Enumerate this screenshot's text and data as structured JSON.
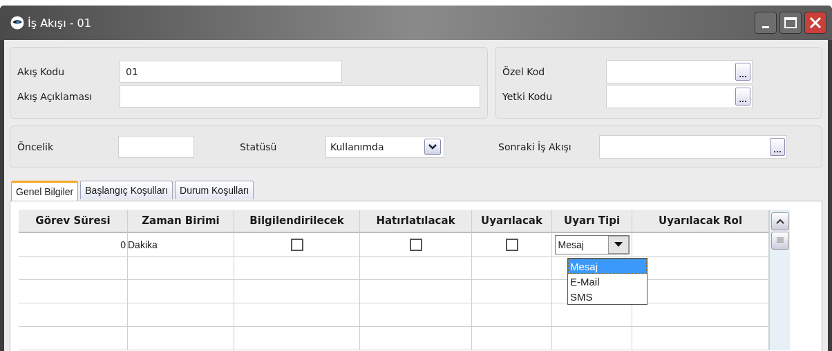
{
  "window": {
    "title": "İş Akışı - 01"
  },
  "header_left": [
    {
      "label": "Akış Kodu",
      "value": "01"
    },
    {
      "label": "Akış Açıklaması"
    }
  ],
  "header_right": [
    {
      "label": "Özel Kod",
      "button": "..."
    },
    {
      "label": "Yetki Kodu",
      "button": "..."
    }
  ],
  "priority": {
    "label": "Öncelik"
  },
  "status": {
    "label": "Statüsü",
    "value": "Kullanımda"
  },
  "next_flow": {
    "label": "Sonraki İş Akışı",
    "button": "..."
  },
  "tabs": [
    {
      "label": "Genel Bilgiler",
      "selected": true
    },
    {
      "label": "Başlangıç Koşulları",
      "selected": false
    },
    {
      "label": "Durum Koşulları",
      "selected": false
    }
  ],
  "table": {
    "columns": [
      "Görev Süresi",
      "Zaman Birimi",
      "Bilgilendirilecek",
      "Hatırlatılacak",
      "Uyarılacak",
      "Uyarı Tipi",
      "Uyarılacak Rol"
    ],
    "rows": [
      {
        "duration": "0",
        "unit": "Dakika",
        "inform": false,
        "remind": false,
        "warn": false,
        "warn_type": "Mesaj"
      }
    ],
    "warn_type_list": [
      {
        "label": "Mesaj",
        "selected": true
      },
      {
        "label": "E-Mail",
        "selected": false
      },
      {
        "label": "SMS",
        "selected": false
      }
    ]
  }
}
